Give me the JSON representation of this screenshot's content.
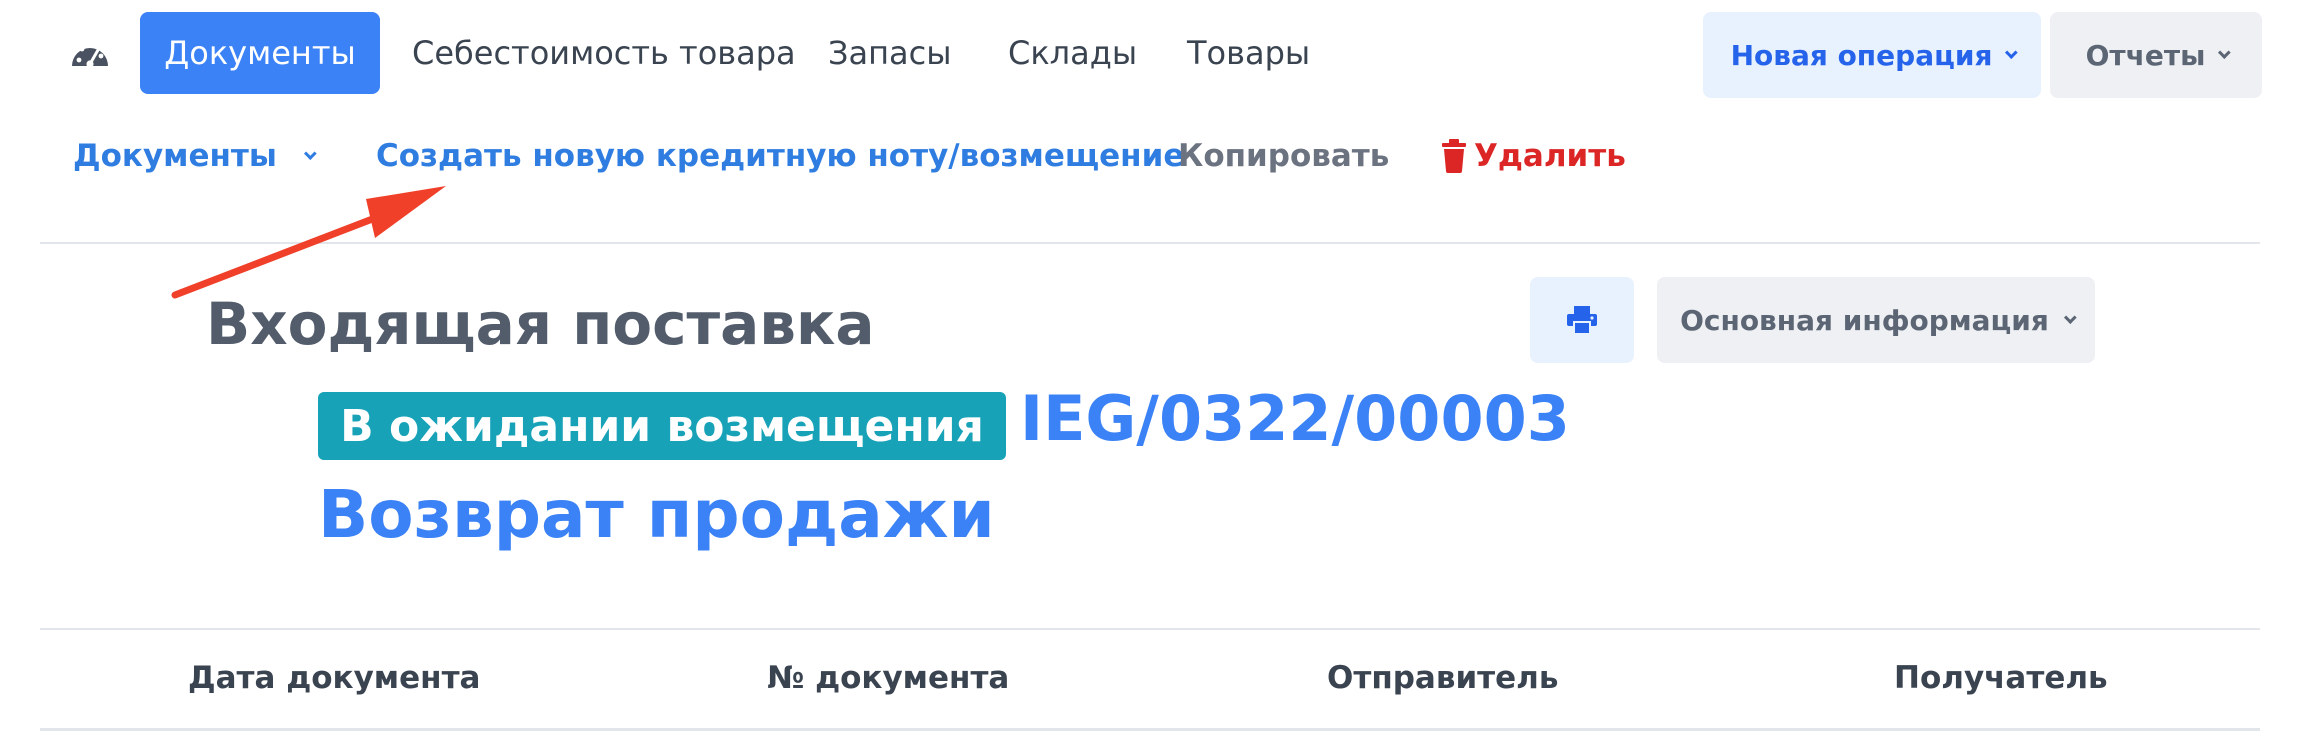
{
  "topnav": {
    "dashboard_icon": "dashboard-gauge-icon",
    "active_tab": "Документы",
    "tabs": [
      "Себестоимость товара",
      "Запасы",
      "Склады",
      "Товары"
    ],
    "new_operation": "Новая операция",
    "reports": "Отчеты"
  },
  "subnav": {
    "documents": "Документы",
    "create_credit_note": "Создать новую кредитную ноту/возмещение",
    "copy": "Копировать",
    "delete": "Удалить",
    "delete_icon": "trash-icon"
  },
  "document": {
    "title": "Входящая поставка",
    "print_icon": "print-icon",
    "info_button": "Основная информация",
    "status": "В ожидании возмещения",
    "number": "IEG/0322/00003",
    "subtitle": "Возврат продажи"
  },
  "table": {
    "columns": [
      "Дата документа",
      "№ документа",
      "Отправитель",
      "Получатель"
    ]
  },
  "colors": {
    "primary": "#3b82f6",
    "status": "#17a2b8",
    "danger": "#dc2626",
    "annotation_arrow": "#f0402a"
  }
}
